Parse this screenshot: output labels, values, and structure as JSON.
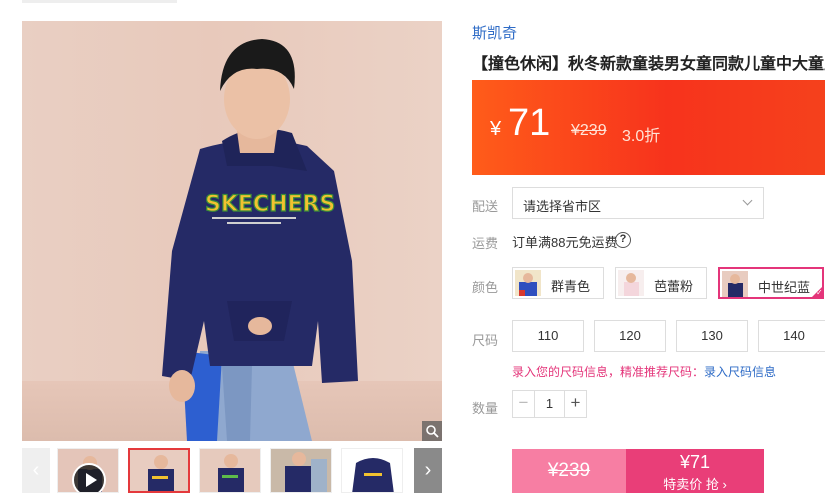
{
  "brand": "斯凯奇",
  "title": "【撞色休闲】秋冬新款童装男女童同款儿童中大童卫衣",
  "price": {
    "currency": "¥",
    "current": "71",
    "original": "¥239",
    "discount": "3.0折"
  },
  "delivery": {
    "label": "配送",
    "placeholder": "请选择省市区"
  },
  "shipping": {
    "label": "运费",
    "text": "订单满88元免运费",
    "help": "?"
  },
  "colors": {
    "label": "颜色",
    "options": [
      {
        "label": "群青色",
        "selected": false
      },
      {
        "label": "芭蕾粉",
        "selected": false
      },
      {
        "label": "中世纪蓝",
        "selected": true
      }
    ]
  },
  "sizes": {
    "label": "尺码",
    "options": [
      "110",
      "120",
      "130",
      "140"
    ],
    "hint_prefix": "录入您的尺码信息，精准推荐尺码：",
    "hint_link": "录入尺码信息"
  },
  "quantity": {
    "label": "数量",
    "value": "1",
    "minus": "−",
    "plus": "+"
  },
  "buy": {
    "original": "¥239",
    "price": "¥71",
    "action": "特卖价 抢 ›"
  },
  "gallery": {
    "prev": "‹",
    "next": "›",
    "thumb_count": 5,
    "active_thumb": 1
  },
  "colors_palette": {
    "hoodie": "#252a66",
    "accent": "#e4357a",
    "price_band": "#f7331c",
    "link": "#2e6bc6"
  }
}
